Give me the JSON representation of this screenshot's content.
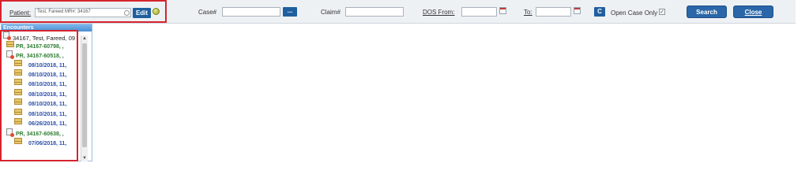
{
  "toolbar": {
    "patient_label": "Patient:",
    "patient_value": "Test, Fareed  MR#:  34167",
    "edit_label": "Edit",
    "case_label": "Case#",
    "case_value": "",
    "case_lookup_label": "...",
    "claim_label": "Claim#",
    "claim_value": "",
    "dos_from_label": "DOS From:",
    "dos_from_value": "",
    "to_label": "To:",
    "to_value": "",
    "clear_label": "C",
    "open_case_label": "Open Case Only",
    "open_case_checked": "✓",
    "search_label": "Search",
    "close_label": "Close"
  },
  "panel": {
    "title": "Encounters",
    "scroll_up": "▲",
    "scroll_down": "▼",
    "tree": [
      {
        "kind": "root",
        "icon": "document-icon",
        "label": "34167, Test, Fareed, 09"
      },
      {
        "kind": "pr",
        "icon": "envelope-icon",
        "label": "PR, 34167-60798, ,"
      },
      {
        "kind": "pr",
        "icon": "document-icon",
        "label": "PR, 34167-60518, ,"
      },
      {
        "kind": "date",
        "icon": "envelope-icon",
        "label": "08/10/2018, 11,"
      },
      {
        "kind": "date",
        "icon": "envelope-icon",
        "label": "08/10/2018, 11,"
      },
      {
        "kind": "date",
        "icon": "envelope-icon",
        "label": "08/10/2018, 11,"
      },
      {
        "kind": "date",
        "icon": "envelope-icon",
        "label": "08/10/2018, 11,"
      },
      {
        "kind": "date",
        "icon": "envelope-icon",
        "label": "08/10/2018, 11,"
      },
      {
        "kind": "date",
        "icon": "envelope-icon",
        "label": "08/10/2018, 11,"
      },
      {
        "kind": "date",
        "icon": "envelope-icon",
        "label": "06/26/2018, 11,"
      },
      {
        "kind": "pr",
        "icon": "document-icon",
        "label": "PR, 34167-60638, ,"
      },
      {
        "kind": "date",
        "icon": "envelope-icon",
        "label": "07/06/2018, 11,"
      }
    ]
  }
}
